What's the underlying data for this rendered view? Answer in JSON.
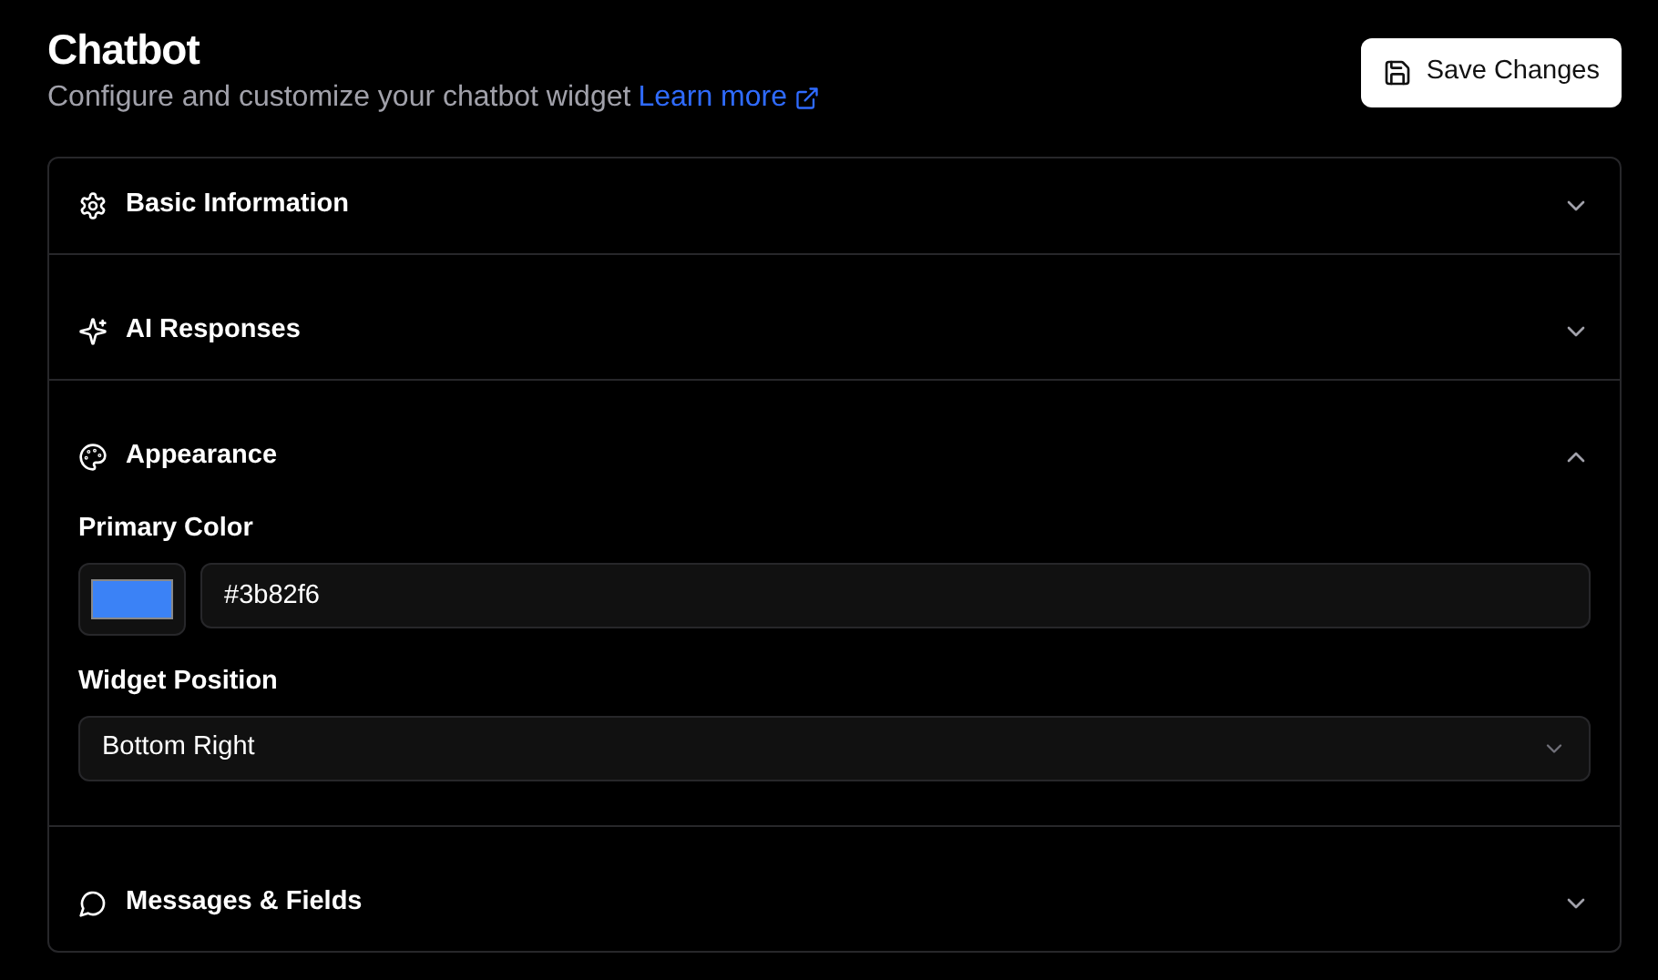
{
  "header": {
    "title": "Chatbot",
    "subtitle": "Configure and customize your chatbot widget",
    "link": "Learn more"
  },
  "save_button": "Save Changes",
  "sections": [
    {
      "kind": "gear",
      "title": "Basic Information",
      "expanded": false
    },
    {
      "kind": "sparkles",
      "title": "AI Responses",
      "expanded": false
    },
    {
      "kind": "palette",
      "title": "Appearance",
      "expanded": true,
      "fields": [
        {
          "kind": "color",
          "label": "Primary Color",
          "value": "#3b82f6",
          "color": "#3b82f6"
        },
        {
          "kind": "select",
          "label": "Widget Position",
          "value": "Bottom Right"
        }
      ]
    },
    {
      "kind": "chat",
      "title": "Messages & Fields",
      "expanded": false
    }
  ]
}
